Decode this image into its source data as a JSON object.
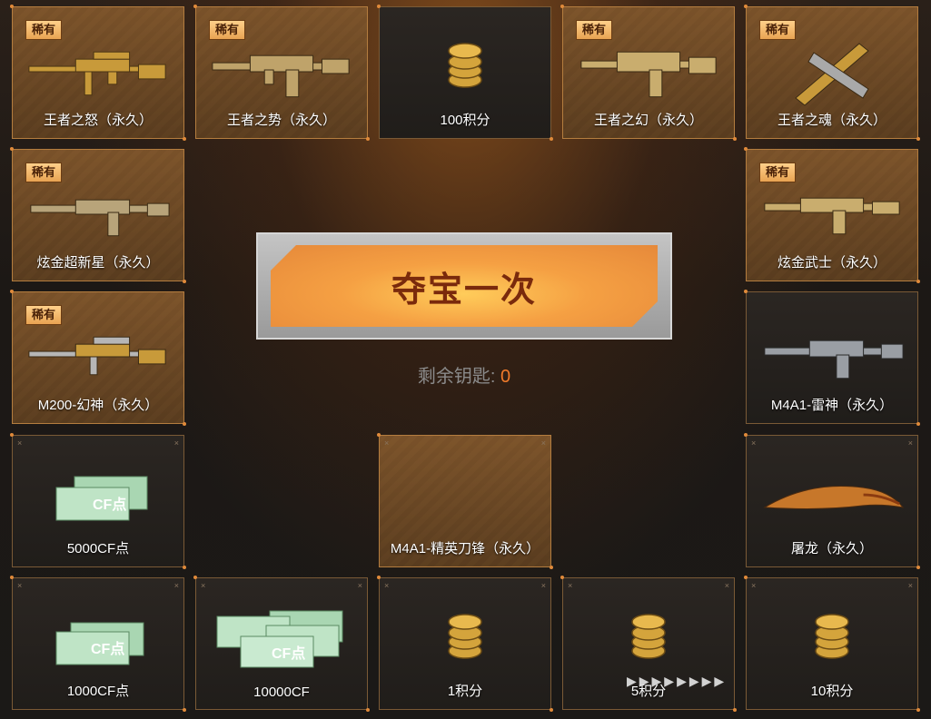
{
  "rare_badge": "稀有",
  "corner_mark": "×",
  "prizes": [
    {
      "label": "王者之怒（永久）",
      "rare": true,
      "gold": true,
      "icon": "sniper-rifle-icon"
    },
    {
      "label": "王者之势（永久）",
      "rare": true,
      "gold": true,
      "icon": "assault-rifle-icon"
    },
    {
      "label": "100积分",
      "rare": false,
      "gold": false,
      "icon": "coin-stack-icon"
    },
    {
      "label": "王者之幻（永久）",
      "rare": true,
      "gold": true,
      "icon": "assault-rifle-icon"
    },
    {
      "label": "王者之魂（永久）",
      "rare": true,
      "gold": true,
      "icon": "dual-pistols-icon"
    },
    {
      "label": "炫金超新星（永久）",
      "rare": true,
      "gold": true,
      "icon": "assault-rifle-icon"
    },
    {
      "label": "炫金武士（永久）",
      "rare": true,
      "gold": true,
      "icon": "assault-rifle-icon"
    },
    {
      "label": "M200-幻神（永久）",
      "rare": true,
      "gold": true,
      "icon": "sniper-rifle-icon"
    },
    {
      "label": "M4A1-雷神（永久）",
      "rare": false,
      "gold": false,
      "icon": "assault-rifle-icon"
    },
    {
      "label": "5000CF点",
      "rare": false,
      "gold": false,
      "icon": "cf-ticket-icon"
    },
    {
      "label": "M4A1-精英刀锋（永久）",
      "rare": false,
      "gold": true,
      "icon": ""
    },
    {
      "label": "屠龙（永久）",
      "rare": false,
      "gold": false,
      "icon": "knife-icon"
    },
    {
      "label": "1000CF点",
      "rare": false,
      "gold": false,
      "icon": "cf-ticket-icon"
    },
    {
      "label": "10000CF",
      "rare": false,
      "gold": false,
      "icon": "cf-ticket-stack-icon"
    },
    {
      "label": "1积分",
      "rare": false,
      "gold": false,
      "icon": "coin-stack-icon"
    },
    {
      "label": "5积分",
      "rare": false,
      "gold": false,
      "icon": "coin-stack-icon"
    },
    {
      "label": "10积分",
      "rare": false,
      "gold": false,
      "icon": "coin-stack-icon"
    }
  ],
  "draw_button": {
    "label": "夺宝一次"
  },
  "keys": {
    "label": "剩余钥匙:",
    "count": "0"
  },
  "watermark": "▶▶▶▶▶▶▶▶"
}
